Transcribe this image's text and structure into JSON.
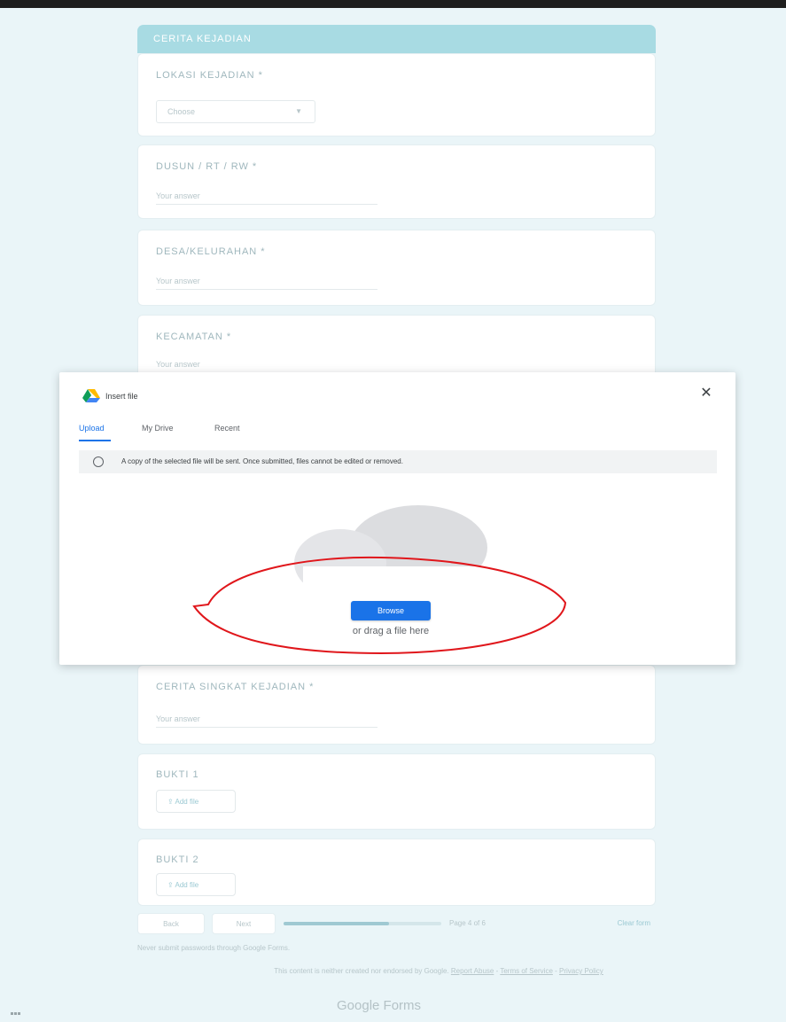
{
  "form": {
    "section_title": "CERITA KEJADIAN",
    "questions": [
      {
        "label": "LOKASI KEJADIAN *",
        "select_value": "Choose"
      },
      {
        "label": "DUSUN / RT / RW *",
        "placeholder": "Your answer"
      },
      {
        "label": "DESA/KELURAHAN *",
        "placeholder": "Your answer"
      },
      {
        "label": "KECAMATAN *",
        "placeholder": "Your answer"
      },
      {
        "label": "CERITA SINGKAT KEJADIAN *",
        "placeholder": "Your answer"
      },
      {
        "label": "BUKTI 1",
        "button": "Add file"
      },
      {
        "label": "BUKTI 2",
        "button": "Add file"
      }
    ],
    "nav": {
      "back": "Back",
      "next": "Next",
      "page_indicator": "Page 4 of 6",
      "clear": "Clear form",
      "progress": 0.67
    },
    "footer": {
      "note": "Never submit passwords through Google Forms.",
      "legal_text": "This content is neither created nor endorsed by Google.",
      "report_abuse": "Report Abuse",
      "terms": "Terms of Service",
      "privacy": "Privacy Policy",
      "separator": " - ",
      "brand": "Google Forms"
    }
  },
  "dialog": {
    "title": "Insert file",
    "close_icon": "close-icon",
    "tabs": [
      "Upload",
      "My Drive",
      "Recent"
    ],
    "active_tab": "Upload",
    "info": "A copy of the selected file will be sent. Once submitted, files cannot be edited or removed.",
    "browse_label": "Browse",
    "drag_text": "or drag a file here"
  },
  "colors": {
    "accent": "#1a73e8",
    "header": "#a8dbe3",
    "background": "#eaf5f8",
    "annotation": "#e0161b"
  }
}
